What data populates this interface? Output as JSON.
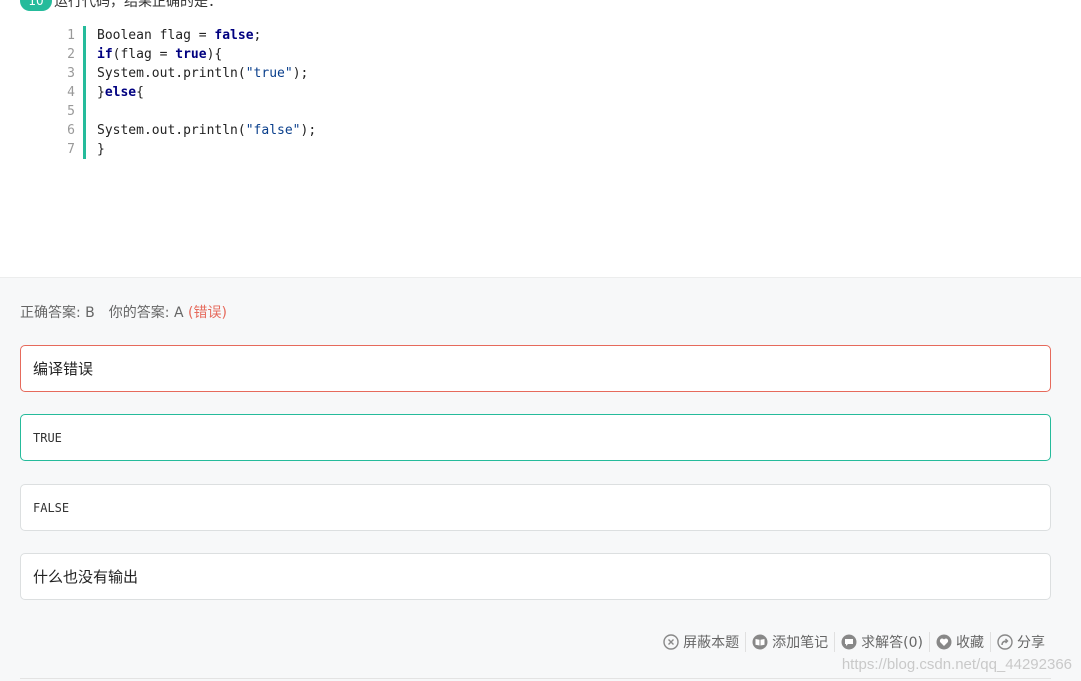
{
  "question": {
    "number": "10",
    "text": "运行代码，结果正确的是："
  },
  "code": {
    "lines": [
      {
        "num": "1"
      },
      {
        "num": "2"
      },
      {
        "num": "3"
      },
      {
        "num": "4"
      },
      {
        "num": "5"
      },
      {
        "num": "6"
      },
      {
        "num": "7"
      }
    ],
    "tokens": {
      "l1_a": "Boolean flag = ",
      "l1_kw": "false",
      "l1_b": ";",
      "l2_kw": "if",
      "l2_a": "(flag = ",
      "l2_kw2": "true",
      "l2_b": "){",
      "l3_a": "System.out.println(",
      "l3_str": "\"true\"",
      "l3_b": ");",
      "l4_a": "}",
      "l4_kw": "else",
      "l4_b": "{",
      "l6_a": "System.out.println(",
      "l6_str": "\"false\"",
      "l6_b": ");",
      "l7_a": "}"
    }
  },
  "result": {
    "correct_label": "正确答案: B",
    "yours_label": "你的答案: A",
    "status": "(错误)"
  },
  "options": [
    {
      "text": "编译错误",
      "state": "wrong"
    },
    {
      "text": "TRUE",
      "state": "correct"
    },
    {
      "text": "FALSE",
      "state": "normal"
    },
    {
      "text": "什么也没有输出",
      "state": "normal"
    }
  ],
  "toolbar": {
    "hide": "屏蔽本题",
    "note": "添加笔记",
    "ask": "求解答(0)",
    "fav": "收藏",
    "share": "分享"
  },
  "watermark": "https://blog.csdn.net/qq_44292366",
  "colors": {
    "accent": "#25bb9b",
    "wrong": "#e66a5c"
  }
}
